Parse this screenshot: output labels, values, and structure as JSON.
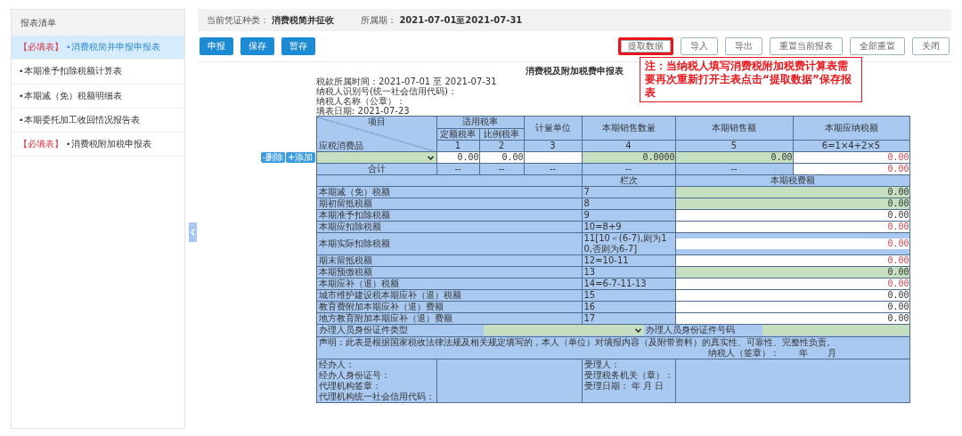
{
  "sidebar": {
    "title": "报表清单",
    "items": [
      {
        "tag": "【必填表】",
        "label": "•消费税简并申报申报表",
        "selected": true
      },
      {
        "label": "•本期准予扣除税额计算表",
        "selected": false
      },
      {
        "label": "•本期减（免）税额明细表",
        "selected": false
      },
      {
        "label": "•本期委托加工收回情况报告表",
        "selected": false
      },
      {
        "tag": "【必填表】",
        "label": "•消费税附加税申报表",
        "selected": false
      }
    ]
  },
  "header": {
    "voucher_label": "当前凭证种类：",
    "voucher_value": "消费税简并征收",
    "period_label": "所属期：",
    "period_value": "2021-07-01至2021-07-31"
  },
  "actions_left": [
    "申报",
    "保存",
    "暂存"
  ],
  "actions_right": [
    {
      "label": "提取数据",
      "highlighted": true
    },
    {
      "label": "导入",
      "highlighted": false
    },
    {
      "label": "导出",
      "highlighted": false
    },
    {
      "label": "重置当前报表",
      "highlighted": false
    },
    {
      "label": "全部重置",
      "highlighted": false
    },
    {
      "label": "关闭",
      "highlighted": false
    }
  ],
  "callout": "注：当纳税人填写消费税附加税费计算表需要再次重新打开主表点击“提取数据”保存报表",
  "form": {
    "title": "消费税及附加税费申报表",
    "info_lines": [
      "税款所属时间：2021-07-01 至 2021-07-31",
      "纳税人识别号(统一社会信用代码)：",
      "纳税人名称（公章）：",
      "填表日期: 2021-07-23"
    ],
    "head": {
      "item": "项目",
      "product": "应税消费品",
      "rate_group": "适用税率",
      "rate_fixed": "定额税率",
      "rate_ratio": "比例税率",
      "unit": "计量单位",
      "quantity": "本期销售数量",
      "sales": "本期销售额",
      "tax_due": "本期应纳税额",
      "numbers": [
        "1",
        "2",
        "3",
        "4",
        "5",
        "6=1×4+2×5"
      ]
    },
    "row_buttons": [
      "-删除",
      "+添加"
    ],
    "entry": {
      "rate_fixed": "0.00",
      "rate_ratio": "0.00",
      "quantity": "0.0000",
      "sales": "0.00",
      "tax_due": "0.00"
    },
    "total": {
      "label": "合计",
      "cells": [
        "--",
        "--",
        "--",
        "--",
        "--"
      ],
      "tax_due": "0.00"
    },
    "detail_head": {
      "column_no": "栏次",
      "amount": "本期税费额"
    },
    "details": [
      {
        "name": "本期减（免）税额",
        "column_no": "7",
        "value": "0.00",
        "kind": "input"
      },
      {
        "name": "期初留抵税额",
        "column_no": "8",
        "value": "0.00",
        "kind": "input"
      },
      {
        "name": "本期准予扣除税额",
        "column_no": "9",
        "value": "0.00",
        "kind": "readonly"
      },
      {
        "name": "本期应扣除税额",
        "column_no": "10=8+9",
        "value": "0.00",
        "kind": "computed"
      },
      {
        "name": "本期实际扣除税额",
        "column_no": "11[10＜(6-7),则为10,否则为6-7]",
        "value": "0.00",
        "kind": "computed"
      },
      {
        "name": "期末留抵税额",
        "column_no": "12=10-11",
        "value": "0.00",
        "kind": "computed"
      },
      {
        "name": "本期预缴税额",
        "column_no": "13",
        "value": "0.00",
        "kind": "input"
      },
      {
        "name": "本期应补（退）税额",
        "column_no": "14=6-7-11-13",
        "value": "0.00",
        "kind": "computed"
      },
      {
        "name": "城市维护建设税本期应补（退）税额",
        "column_no": "15",
        "value": "0.00",
        "kind": "readonly"
      },
      {
        "name": "教育费附加本期应补（退）费额",
        "column_no": "16",
        "value": "0.00",
        "kind": "readonly"
      },
      {
        "name": "地方教育附加本期应补（退）费额",
        "column_no": "17",
        "value": "0.00",
        "kind": "readonly"
      }
    ],
    "agent_id_type": "办理人员身份证件类型",
    "agent_id_number": "办理人员身份证件号码",
    "statement": "声明：此表是根据国家税收法律法规及相关规定填写的，本人（单位）对填报内容（及附带资料）的真实性、可靠性、完整性负责。",
    "signature": {
      "label": "纳税人（签章）：",
      "year": "年",
      "month": "月"
    },
    "handler_lines": [
      "经办人：",
      "经办人身份证号：",
      "代理机构签章：",
      "代理机构统一社会信用代码："
    ],
    "acceptance_lines": [
      "受理人：",
      "受理税务机关（章）：",
      "受理日期：  年 月 日"
    ]
  }
}
